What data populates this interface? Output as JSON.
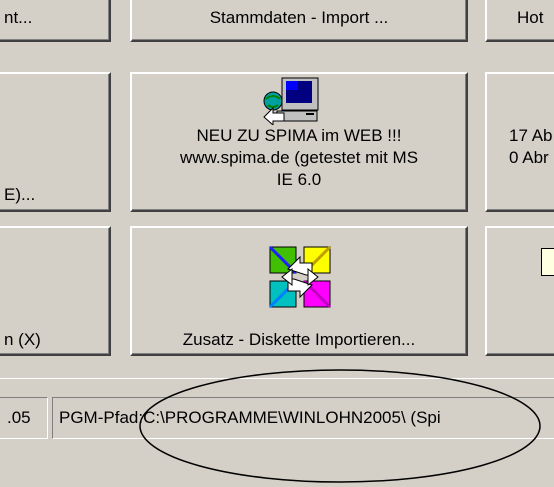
{
  "buttons": {
    "row1_left": "nt...",
    "row1_middle": "Stammdaten - Import ...",
    "row1_right": "Hot",
    "row2_left": "E)...",
    "row2_middle": [
      "NEU ZU SPIMA im WEB !!!",
      "www.spima.de (getestet mit MS",
      "IE 6.0"
    ],
    "row2_right": [
      "17 Ab",
      "0 Abr"
    ],
    "row3_left": "n (X)",
    "row3_middle": "Zusatz - Diskette Importieren..."
  },
  "icons": {
    "web": "computer-globe-icon",
    "import": "arrows-squares-icon"
  },
  "status": {
    "version": ".05",
    "path": "PGM-Pfad:C:\\PROGRAMME\\WINLOHN2005\\ (Spi"
  },
  "colors": {
    "face": "#d4d0c8",
    "highlight": "#ffffff",
    "shadow": "#808080",
    "dark_shadow": "#404040",
    "annotation": "#000000"
  }
}
